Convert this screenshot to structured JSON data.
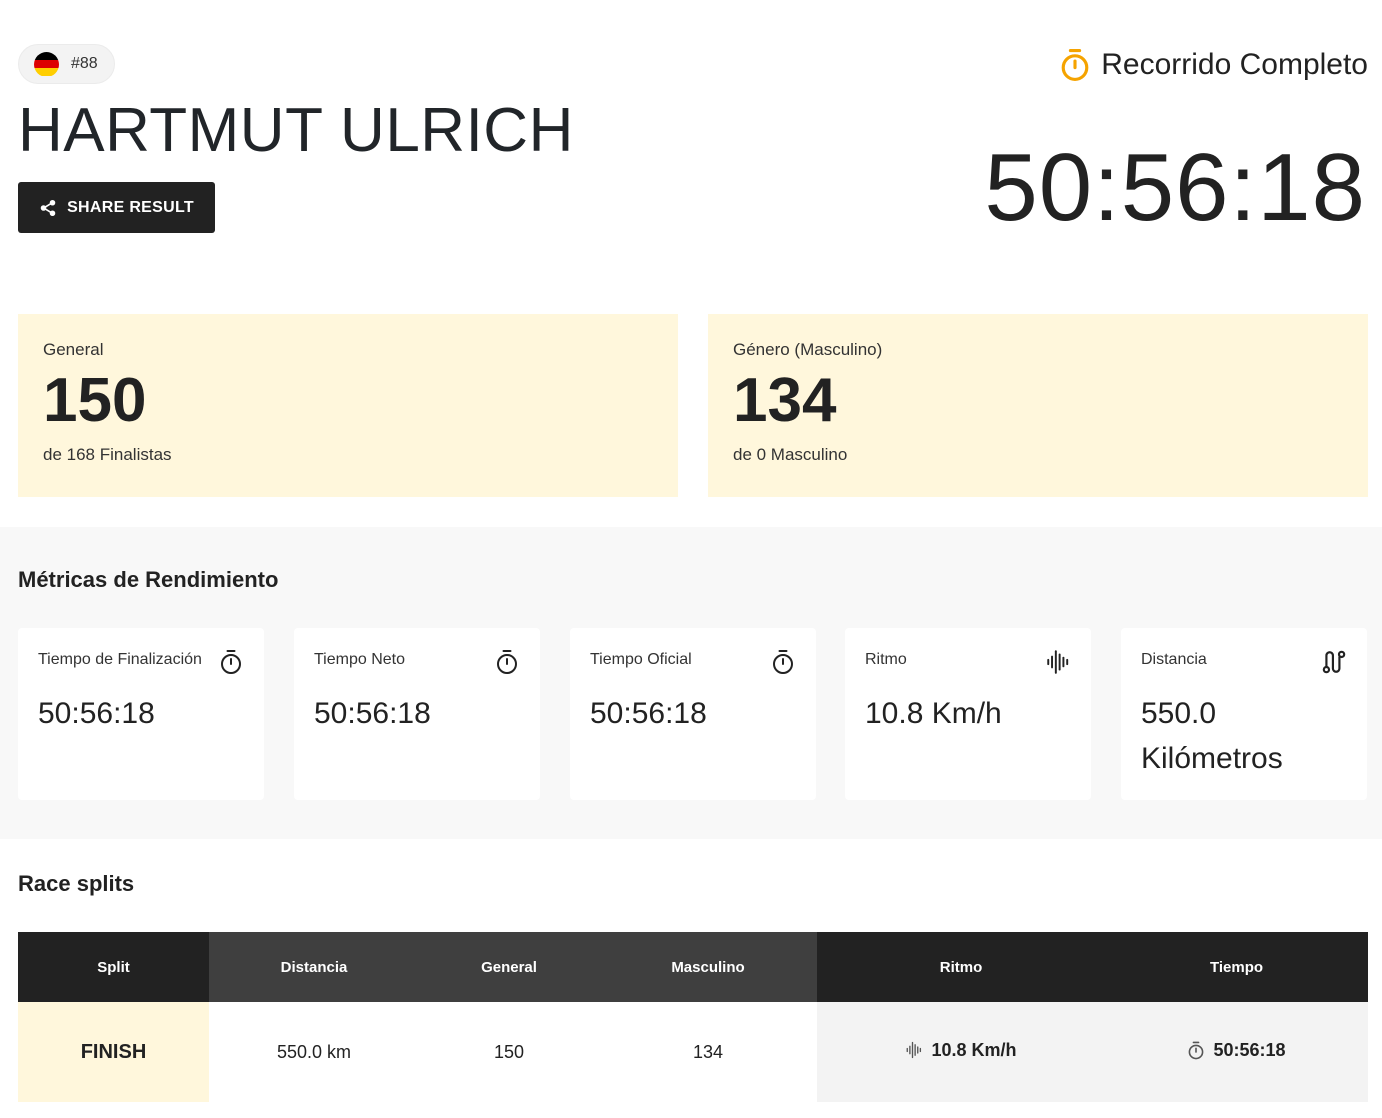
{
  "athlete": {
    "bib": "#88",
    "name": "HARTMUT ULRICH",
    "flag_colors": [
      "#000000",
      "#dd0000",
      "#ffce00"
    ]
  },
  "header": {
    "share_label": "SHARE RESULT",
    "status_label": "Recorrido Completo",
    "status_icon": "stopwatch-icon",
    "status_color": "#f5a300",
    "finish_time": "50:56:18"
  },
  "rankings": [
    {
      "label": "General",
      "value": "150",
      "sub": "de 168 Finalistas"
    },
    {
      "label": "Género (Masculino)",
      "value": "134",
      "sub": "de 0 Masculino"
    }
  ],
  "metrics": {
    "title": "Métricas de Rendimiento",
    "cards": [
      {
        "label": "Tiempo de Finalización",
        "value": "50:56:18",
        "icon": "stopwatch-icon"
      },
      {
        "label": "Tiempo Neto",
        "value": "50:56:18",
        "icon": "stopwatch-icon"
      },
      {
        "label": "Tiempo Oficial",
        "value": "50:56:18",
        "icon": "stopwatch-icon"
      },
      {
        "label": "Ritmo",
        "value": "10.8 Km/h",
        "icon": "waveform-icon"
      },
      {
        "label": "Distancia",
        "value": "550.0 Kilómetros",
        "icon": "route-icon"
      }
    ]
  },
  "splits": {
    "title": "Race splits",
    "columns": [
      "Split",
      "Distancia",
      "General",
      "Masculino",
      "Ritmo",
      "Tiempo"
    ],
    "rows": [
      {
        "split": "FINISH",
        "distance": "550.0 km",
        "general": "150",
        "gender": "134",
        "pace": "10.8 Km/h",
        "time": "50:56:18"
      }
    ]
  },
  "colors": {
    "highlight_bg": "#fff7dc",
    "dark": "#222222",
    "accent": "#f5a300"
  }
}
